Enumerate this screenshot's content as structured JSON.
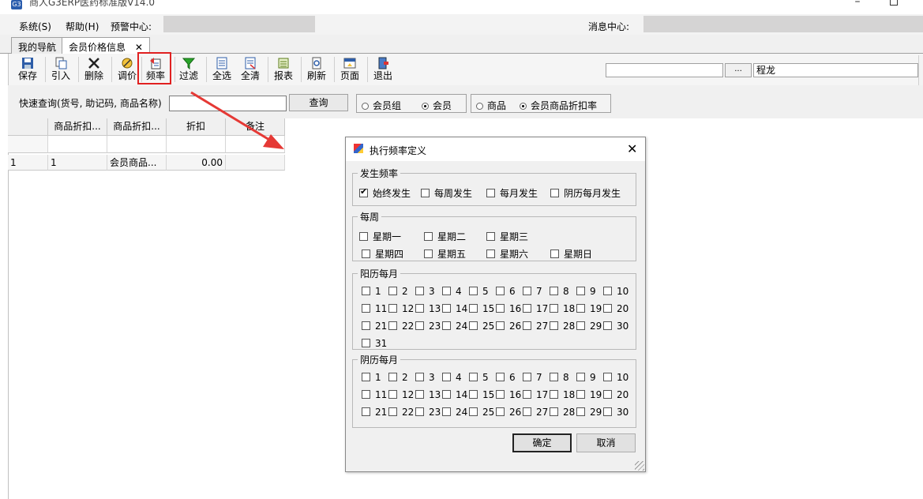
{
  "app": {
    "title": "商人G3ERP医药标准版V14.0",
    "icon_label": "G3"
  },
  "menu": {
    "system": "系统(S)",
    "help": "帮助(H)",
    "alert_center": "预警中心:",
    "message_center": "消息中心:"
  },
  "tabs": [
    {
      "label": "我的导航"
    },
    {
      "label": "会员价格信息",
      "close": "✕"
    }
  ],
  "toolbar": {
    "buttons": [
      {
        "label": "保存",
        "icon": "save-icon"
      },
      {
        "label": "引入",
        "icon": "import-icon"
      },
      {
        "label": "删除",
        "icon": "delete-icon"
      },
      {
        "label": "调价",
        "icon": "adjust-price-icon"
      },
      {
        "label": "频率",
        "icon": "frequency-icon"
      },
      {
        "label": "过滤",
        "icon": "filter-icon"
      },
      {
        "label": "全选",
        "icon": "select-all-icon"
      },
      {
        "label": "全清",
        "icon": "clear-all-icon"
      },
      {
        "label": "报表",
        "icon": "report-icon"
      },
      {
        "label": "刷新",
        "icon": "refresh-icon"
      },
      {
        "label": "页面",
        "icon": "page-icon"
      },
      {
        "label": "退出",
        "icon": "exit-icon"
      }
    ],
    "browse_button": "...",
    "user_value": "程龙"
  },
  "query": {
    "label": "快速查询(货号, 助记码, 商品名称)",
    "button": "查询",
    "group1": [
      {
        "label": "会员组",
        "checked": false
      },
      {
        "label": "会员",
        "checked": true
      }
    ],
    "group2": [
      {
        "label": "商品",
        "checked": false
      },
      {
        "label": "会员商品折扣率",
        "checked": true
      }
    ]
  },
  "grid": {
    "columns": [
      "",
      "商品折扣...",
      "商品折扣...",
      "折扣",
      "备注"
    ],
    "rows": [
      [
        "1",
        "1",
        "会员商品...",
        "0.00",
        ""
      ]
    ]
  },
  "dialog": {
    "title": "执行频率定义",
    "close": "✕",
    "freq": {
      "legend": "发生频率",
      "options": [
        {
          "label": "始终发生",
          "checked": true
        },
        {
          "label": "每周发生",
          "checked": false
        },
        {
          "label": "每月发生",
          "checked": false
        },
        {
          "label": "阴历每月发生",
          "checked": false
        }
      ]
    },
    "weekly": {
      "legend": "每周",
      "days": [
        "星期一",
        "星期二",
        "星期三",
        "星期四",
        "星期五",
        "星期六",
        "星期日"
      ]
    },
    "solar": {
      "legend": "阳历每月",
      "days": [
        "1",
        "2",
        "3",
        "4",
        "5",
        "6",
        "7",
        "8",
        "9",
        "10",
        "11",
        "12",
        "13",
        "14",
        "15",
        "16",
        "17",
        "18",
        "19",
        "20",
        "21",
        "22",
        "23",
        "24",
        "25",
        "26",
        "27",
        "28",
        "29",
        "30",
        "31"
      ]
    },
    "lunar": {
      "legend": "阴历每月",
      "days": [
        "1",
        "2",
        "3",
        "4",
        "5",
        "6",
        "7",
        "8",
        "9",
        "10",
        "11",
        "12",
        "13",
        "14",
        "15",
        "16",
        "17",
        "18",
        "19",
        "20",
        "21",
        "22",
        "23",
        "24",
        "25",
        "26",
        "27",
        "28",
        "29",
        "30"
      ]
    },
    "ok": "确定",
    "cancel": "取消"
  },
  "colors": {
    "highlight": "#e02020",
    "arrow": "#e53935"
  }
}
